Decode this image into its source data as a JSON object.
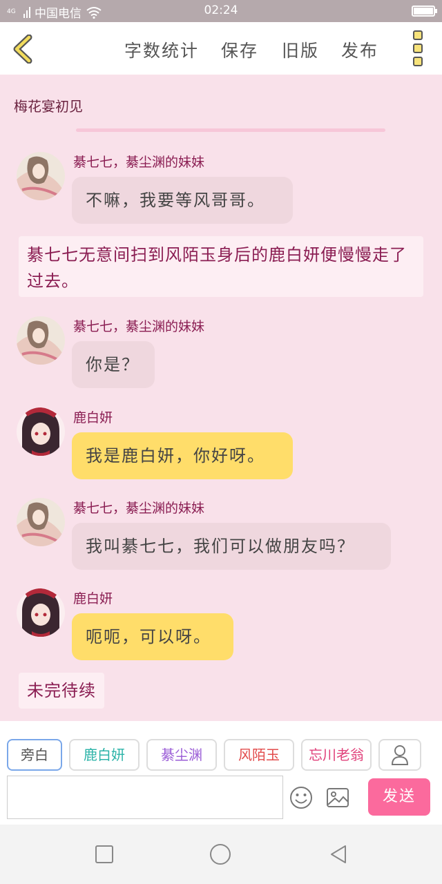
{
  "status_bar": {
    "network": "4G",
    "carrier": "中国电信",
    "time": "02:24",
    "icons": [
      "signal-icon",
      "wifi-icon",
      "battery-icon"
    ]
  },
  "toolbar": {
    "back_icon": "chevron-left-icon",
    "links": [
      "字数统计",
      "保存",
      "旧版",
      "发布"
    ],
    "menu_icon": "more-vertical-icon"
  },
  "chapter": {
    "title": "梅花宴初见"
  },
  "messages": [
    {
      "sender": "綦七七，綦尘渊的妹妹",
      "text": "不嘛，我要等风哥哥。",
      "style": "pink",
      "avatar": "qiqi-avatar"
    },
    {
      "narration": "綦七七无意间扫到风陌玉身后的鹿白妍便慢慢走了过去。"
    },
    {
      "sender": "綦七七，綦尘渊的妹妹",
      "text": "你是？",
      "style": "pink",
      "avatar": "qiqi-avatar"
    },
    {
      "sender": "鹿白妍",
      "text": "我是鹿白妍，你好呀。",
      "style": "yellow",
      "avatar": "baiyan-avatar"
    },
    {
      "sender": "綦七七，綦尘渊的妹妹",
      "text": "我叫綦七七，我们可以做朋友吗？",
      "style": "pink",
      "avatar": "qiqi-avatar"
    },
    {
      "sender": "鹿白妍",
      "text": "呃呃，可以呀。",
      "style": "yellow",
      "avatar": "baiyan-avatar"
    }
  ],
  "to_be_continued": "未完待续",
  "roles": [
    {
      "label": "旁白",
      "color": "#555555"
    },
    {
      "label": "鹿白妍",
      "color": "#2bb3a8"
    },
    {
      "label": "綦尘渊",
      "color": "#9a5cd6"
    },
    {
      "label": "风陌玉",
      "color": "#e24b4b"
    },
    {
      "label": "忘川老翁",
      "color": "#e0407a"
    }
  ],
  "composer": {
    "input_value": "",
    "emoji_icon": "smiley-icon",
    "image_icon": "image-icon",
    "add_role_icon": "user-icon",
    "send_label": "发送"
  },
  "colors": {
    "background": "#f9e1ea",
    "accent_pink": "#fb6a9d",
    "bubble_yellow": "#ffdd6a",
    "bubble_pink": "#efd7de",
    "name_color": "#8a1d52"
  }
}
